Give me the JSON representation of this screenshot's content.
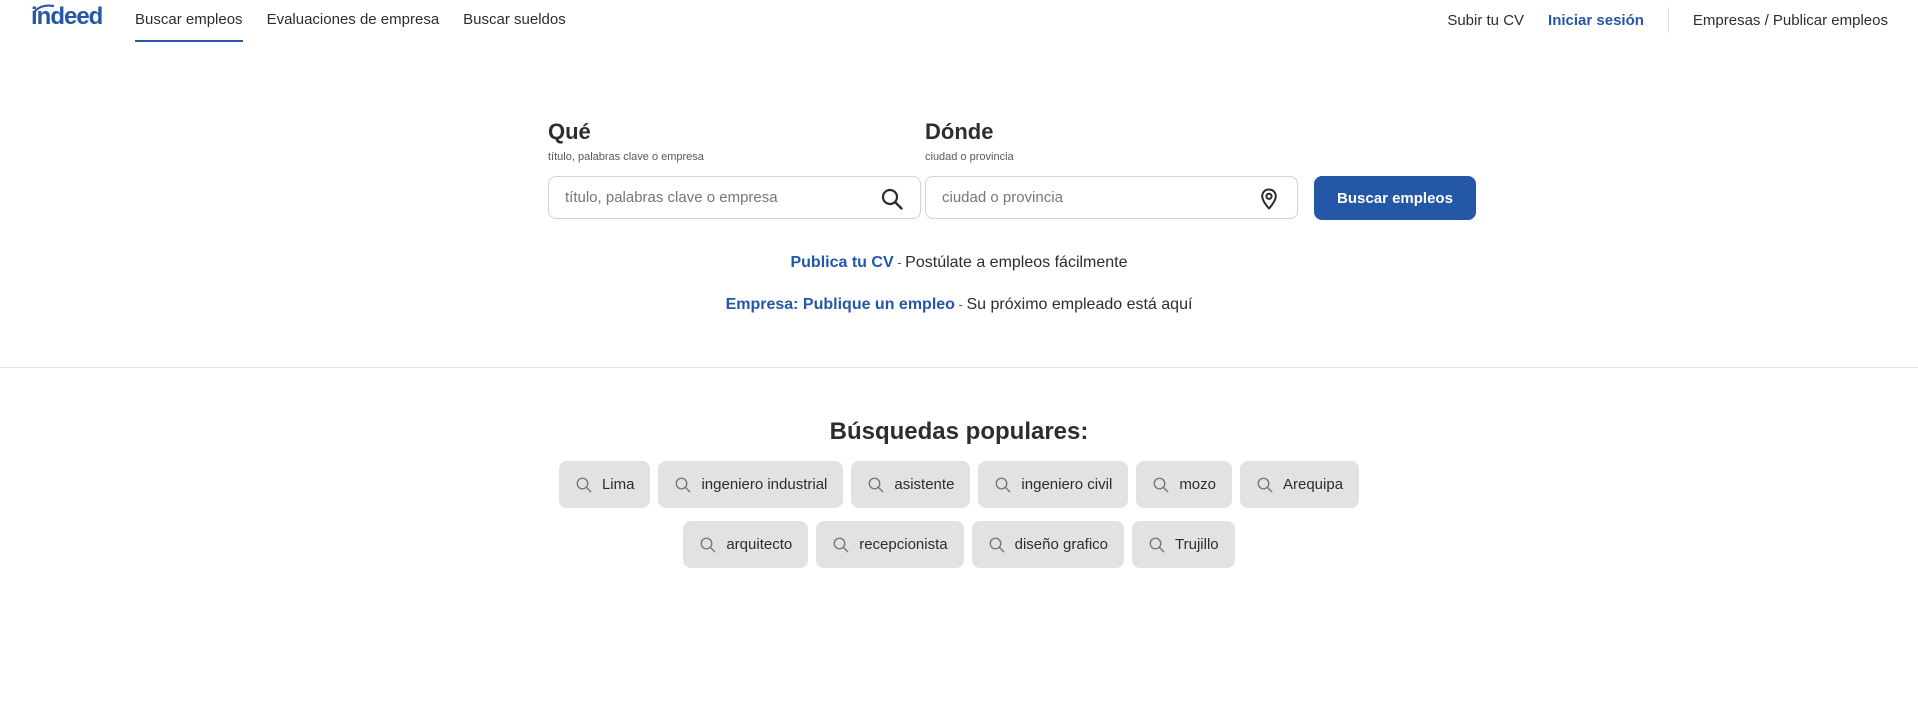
{
  "header": {
    "logo_text": "indeed",
    "nav_left": [
      {
        "label": "Buscar empleos",
        "active": true
      },
      {
        "label": "Evaluaciones de empresa",
        "active": false
      },
      {
        "label": "Buscar sueldos",
        "active": false
      }
    ],
    "upload_cv": "Subir tu CV",
    "login": "Iniciar sesión",
    "employers": "Empresas / Publicar empleos"
  },
  "search": {
    "what_title": "Qué",
    "what_sub": "título, palabras clave o empresa",
    "what_placeholder": "título, palabras clave o empresa",
    "what_value": "",
    "where_title": "Dónde",
    "where_sub": "ciudad o provincia",
    "where_placeholder": "ciudad o provincia",
    "where_value": "",
    "button_label": "Buscar empleos"
  },
  "promo": {
    "cv_link": "Publica tu CV",
    "cv_sep": " - ",
    "cv_text": "Postúlate a empleos fácilmente",
    "employer_link": "Empresa: Publique un empleo",
    "employer_sep": " - ",
    "employer_text": "Su próximo empleado está aquí"
  },
  "popular": {
    "title": "Búsquedas populares:",
    "row1": [
      "Lima",
      "ingeniero industrial",
      "asistente",
      "ingeniero civil",
      "mozo",
      "Arequipa"
    ],
    "row2": [
      "arquitecto",
      "recepcionista",
      "diseño grafico",
      "Trujillo"
    ]
  },
  "colors": {
    "brand": "#2557a7",
    "chip_bg": "#e4e2e0",
    "text": "#2d2d2d"
  },
  "icons": [
    "search-icon",
    "location-pin-icon"
  ]
}
